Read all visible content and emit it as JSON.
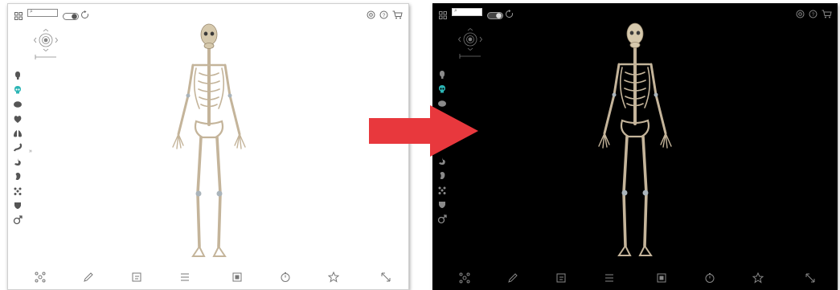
{
  "panels": [
    {
      "theme": "light",
      "background": "#ffffff",
      "icon_color": "#555555",
      "highlight_color": "#2cb5b5"
    },
    {
      "theme": "dark",
      "background": "#000000",
      "icon_color": "#8a8a8a",
      "highlight_color": "#2cb5b5"
    }
  ],
  "topbar": {
    "search_glyph": "⌕",
    "left_icons": [
      "grid-icon",
      "search-field",
      "dark-mode-toggle-icon",
      "reset-icon"
    ],
    "right_icons": [
      "settings-icon",
      "help-icon",
      "cart-icon"
    ]
  },
  "side_menu": {
    "items": [
      "head-icon",
      "skull-icon",
      "brain-icon",
      "heart-icon",
      "lungs-icon",
      "digestive-icon",
      "stomach-icon",
      "kidney-icon",
      "lymph-icon",
      "pelvis-icon",
      "male-icon"
    ],
    "selected_index": 1,
    "tab_glyph": "»"
  },
  "bottom_toolbar": {
    "items": [
      "explode-icon",
      "pen-icon",
      "note-icon",
      "list-icon",
      "layers-icon",
      "timer-icon",
      "star-icon",
      "expand-icon"
    ]
  },
  "arrow": {
    "color": "#e8383d"
  }
}
